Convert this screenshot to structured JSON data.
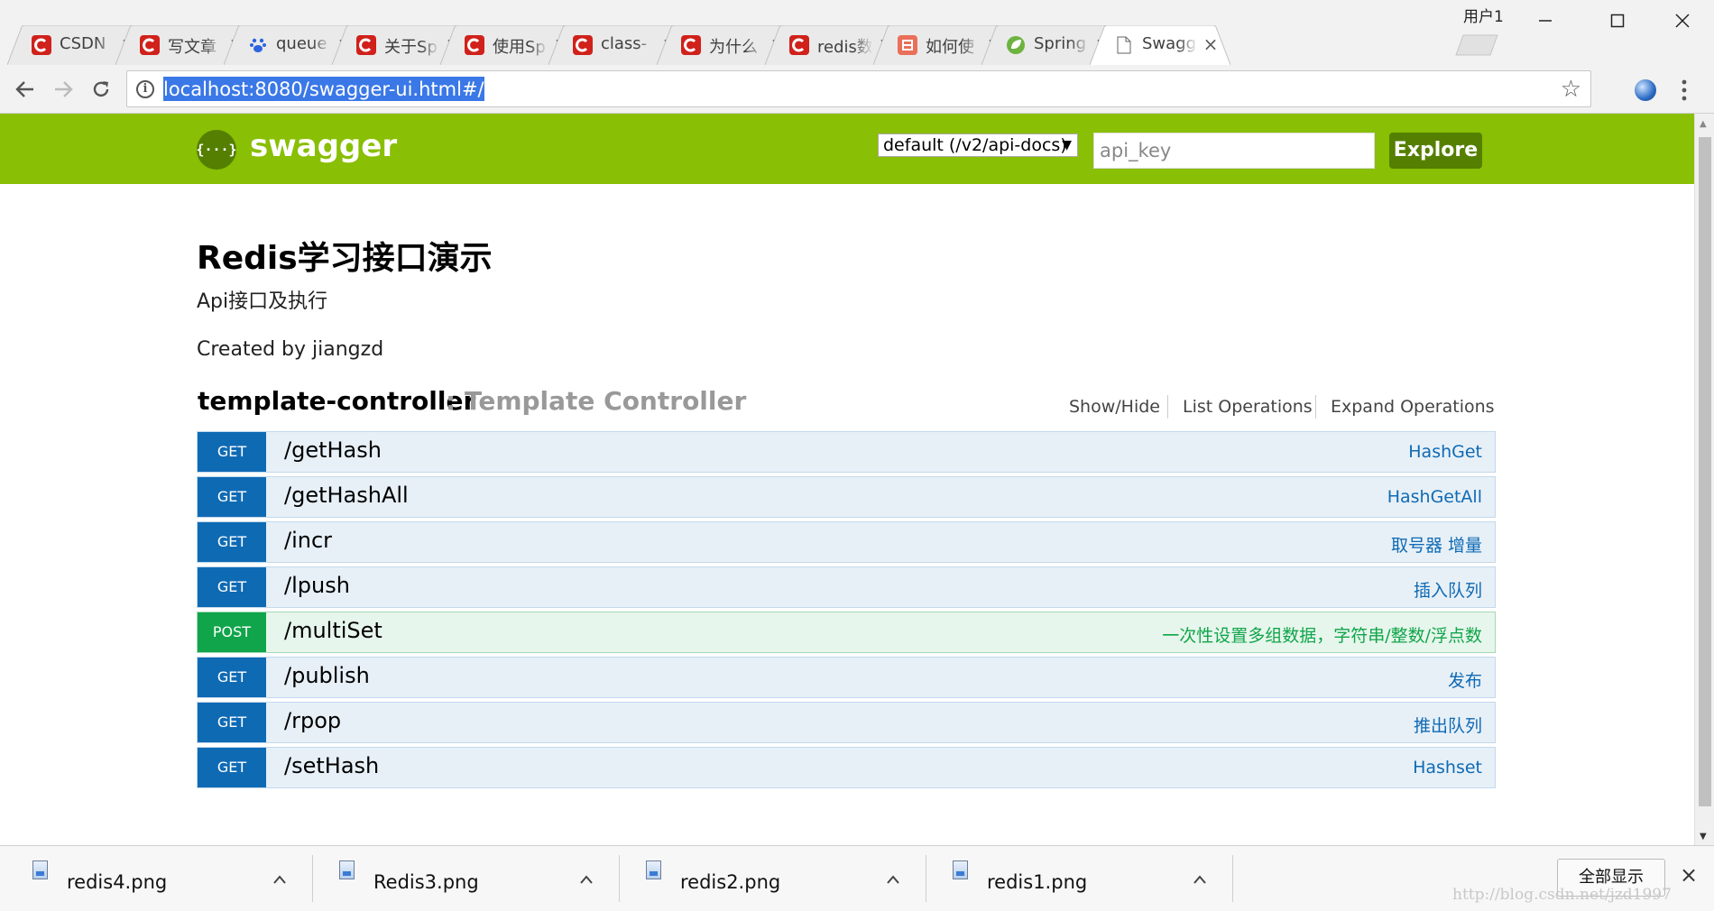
{
  "browser": {
    "user_label": "用户1",
    "tabs": [
      {
        "title": "CSDN",
        "icon": "csdn-icon",
        "active": false
      },
      {
        "title": "写文章",
        "icon": "csdn-icon",
        "active": false
      },
      {
        "title": "queue",
        "icon": "baidu-paw-icon",
        "active": false
      },
      {
        "title": "关于Sp",
        "icon": "csdn-icon",
        "active": false
      },
      {
        "title": "使用Sp",
        "icon": "csdn-icon",
        "active": false
      },
      {
        "title": "class-",
        "icon": "csdn-icon",
        "active": false
      },
      {
        "title": "为什么",
        "icon": "csdn-icon",
        "active": false
      },
      {
        "title": "redis数",
        "icon": "csdn-icon",
        "active": false
      },
      {
        "title": "如何使",
        "icon": "jianshu-icon",
        "active": false
      },
      {
        "title": "Spring",
        "icon": "spring-leaf-icon",
        "active": false
      },
      {
        "title": "Swagg",
        "icon": "page-icon",
        "active": true
      }
    ],
    "tab_close_glyph": "×",
    "address": "localhost:8080/swagger-ui.html#/",
    "colors": {
      "csdn_red": "#d0211b",
      "jianshu": "#ea6f5a",
      "baidu": "#2d64e0",
      "spring_green": "#6db33f",
      "selection_blue": "#3b78e7"
    }
  },
  "swagger": {
    "brand": "swagger",
    "logo_glyph": "{···}",
    "spec_select": "default (/v2/api-docs)",
    "api_key_placeholder": "api_key",
    "explore_label": "Explore",
    "colors": {
      "header_green": "#89bf04",
      "dark_green": "#547f00",
      "get_blue": "#0f6ab4",
      "post_green": "#10a54a"
    }
  },
  "api": {
    "title": "Redis学习接口演示",
    "description": "Api接口及执行",
    "created_by": "Created by jiangzd"
  },
  "controller": {
    "name": "template-controller",
    "description": ": Template Controller",
    "links": {
      "show_hide": "Show/Hide",
      "list_operations": "List Operations",
      "expand_operations": "Expand Operations"
    }
  },
  "operations": [
    {
      "method": "GET",
      "path": "/getHash",
      "summary": "HashGet"
    },
    {
      "method": "GET",
      "path": "/getHashAll",
      "summary": "HashGetAll"
    },
    {
      "method": "GET",
      "path": "/incr",
      "summary": "取号器 增量"
    },
    {
      "method": "GET",
      "path": "/lpush",
      "summary": "插入队列"
    },
    {
      "method": "POST",
      "path": "/multiSet",
      "summary": "一次性设置多组数据，字符串/整数/浮点数"
    },
    {
      "method": "GET",
      "path": "/publish",
      "summary": "发布"
    },
    {
      "method": "GET",
      "path": "/rpop",
      "summary": "推出队列"
    },
    {
      "method": "GET",
      "path": "/setHash",
      "summary": "Hashset"
    }
  ],
  "downloads": {
    "items": [
      {
        "name": "redis4.png"
      },
      {
        "name": "Redis3.png"
      },
      {
        "name": "redis2.png"
      },
      {
        "name": "redis1.png"
      }
    ],
    "show_all": "全部显示",
    "close_glyph": "×"
  },
  "watermark": "http://blog.csdn.net/jzd1997"
}
